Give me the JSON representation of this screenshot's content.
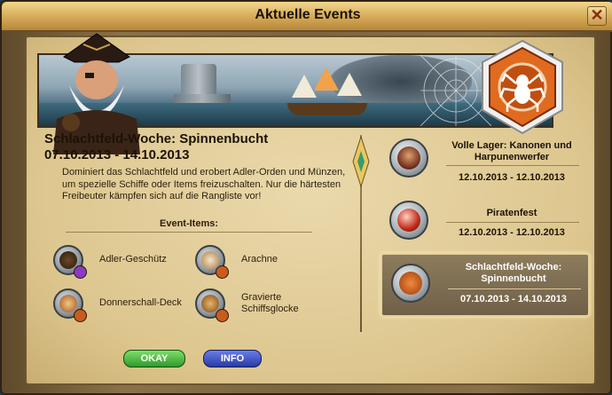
{
  "window": {
    "title": "Aktuelle Events",
    "close_symbol": "✕"
  },
  "event": {
    "title": "Schlachtfeld-Woche: Spinnenbucht",
    "dates": "07.10.2013 - 14.10.2013",
    "description": "Dominiert das Schlachtfeld und erobert Adler-Orden und Münzen, um spezielle Schiffe oder Items freizuschalten. Nur die härtesten Freibeuter kämpfen sich auf die Rangliste vor!",
    "items_heading": "Event-Items:",
    "items": [
      {
        "label": "Adler-Geschütz",
        "icon": "cannon-icon"
      },
      {
        "label": "Arachne",
        "icon": "ship-icon"
      },
      {
        "label": "Donnerschall-Deck",
        "icon": "deck-icon"
      },
      {
        "label": "Gravierte Schiffsglocke",
        "icon": "bell-icon"
      }
    ]
  },
  "event_list": [
    {
      "title": "Volle Lager: Kanonen und Harpunenwerfer",
      "dates": "12.10.2013 - 12.10.2013",
      "icon": "pirate-woman-icon",
      "selected": false
    },
    {
      "title": "Piratenfest",
      "dates": "12.10.2013 - 12.10.2013",
      "icon": "festival-orb-icon",
      "selected": false
    },
    {
      "title": "Schlachtfeld-Woche: Spinnenbucht",
      "dates": "07.10.2013 - 14.10.2013",
      "icon": "spider-icon",
      "selected": true
    }
  ],
  "buttons": {
    "okay": "OKAY",
    "info": "INFO"
  },
  "colors": {
    "okay": "#3aa82f",
    "info": "#3a4cc0",
    "badge": "#e06a1e",
    "title_bar": "#d4a957"
  }
}
